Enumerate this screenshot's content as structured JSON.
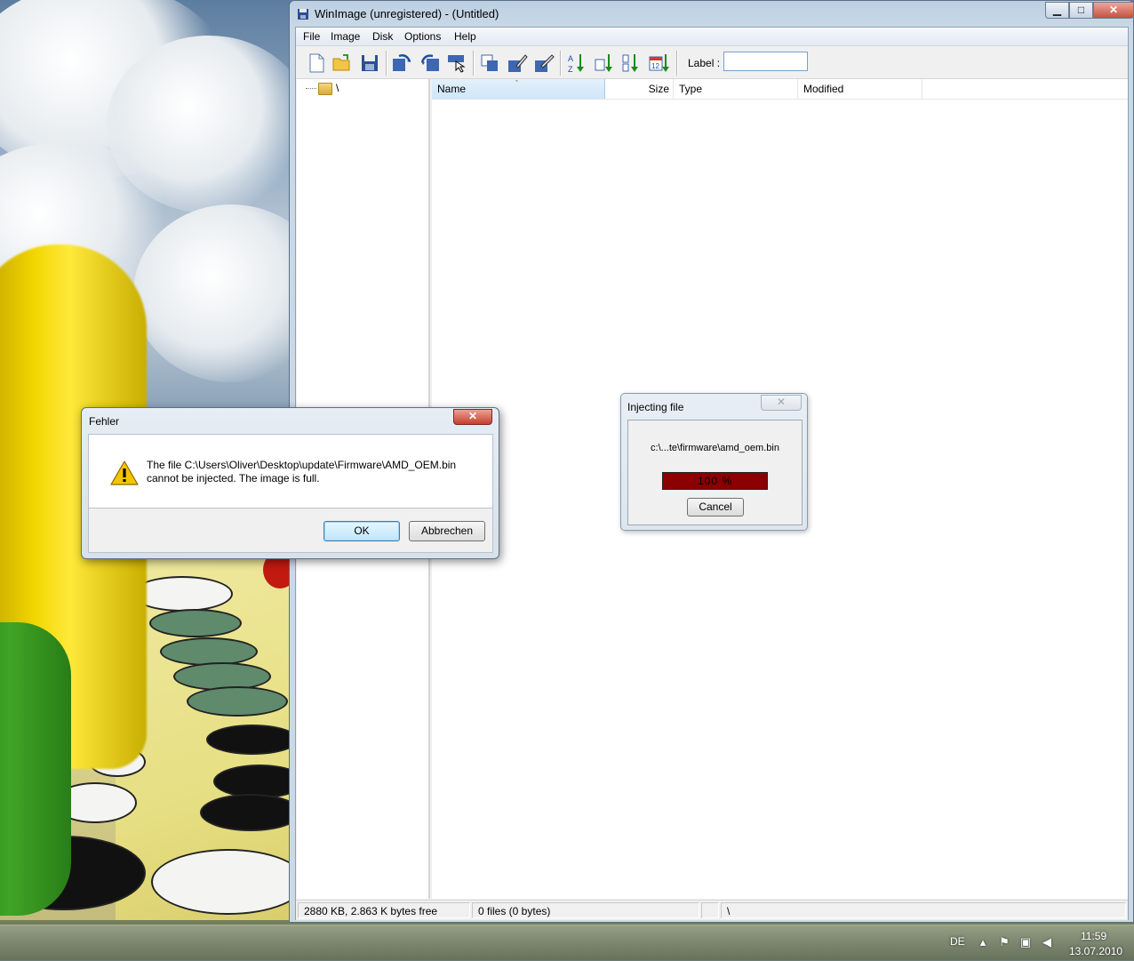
{
  "main_window": {
    "title": "WinImage (unregistered) - (Untitled)",
    "caption_buttons": {
      "minimize": "minimize-icon",
      "maximize": "maximize-icon",
      "close": "close-icon"
    }
  },
  "menu": {
    "items": [
      "File",
      "Image",
      "Disk",
      "Options",
      "Help"
    ]
  },
  "toolbar": {
    "icons": [
      "new-icon",
      "open-icon",
      "save-icon",
      "extract-icon",
      "inject-icon",
      "select-icon",
      "copy-icon",
      "edit-icon",
      "edit-properties-icon",
      "sort-name-icon",
      "sort-size-icon",
      "sort-type-icon",
      "sort-date-icon"
    ],
    "label_caption": "Label :",
    "label_value": ""
  },
  "tree": {
    "root": "\\"
  },
  "list": {
    "columns": [
      "Name",
      "Size",
      "Type",
      "Modified"
    ],
    "rows": []
  },
  "statusbar": {
    "disk": "2880 KB, 2.863 K bytes free",
    "files": "0 files (0 bytes)",
    "empty": "",
    "path": "\\"
  },
  "inject_dialog": {
    "title": "Injecting file",
    "file": "c:\\...te\\firmware\\amd_oem.bin",
    "progress_percent": 100,
    "progress_text": "100 %",
    "cancel_label": "Cancel",
    "close_icon": "close-icon"
  },
  "error_dialog": {
    "title": "Fehler",
    "message_line1": "The file C:\\Users\\Oliver\\Desktop\\update\\Firmware\\AMD_OEM.bin",
    "message_line2": "cannot be injected. The image is full.",
    "icon": "warning-icon",
    "ok_label": "OK",
    "cancel_label": "Abbrechen"
  },
  "taskbar": {
    "language": "DE",
    "time": "11:59",
    "date": "13.07.2010",
    "tray_icons": [
      "show-hidden-icons-icon",
      "action-center-icon",
      "network-icon",
      "volume-icon"
    ]
  },
  "colors": {
    "progress_bar": "#8b0000",
    "close_button": "#c4412c",
    "ok_button": "#bee6fd"
  }
}
